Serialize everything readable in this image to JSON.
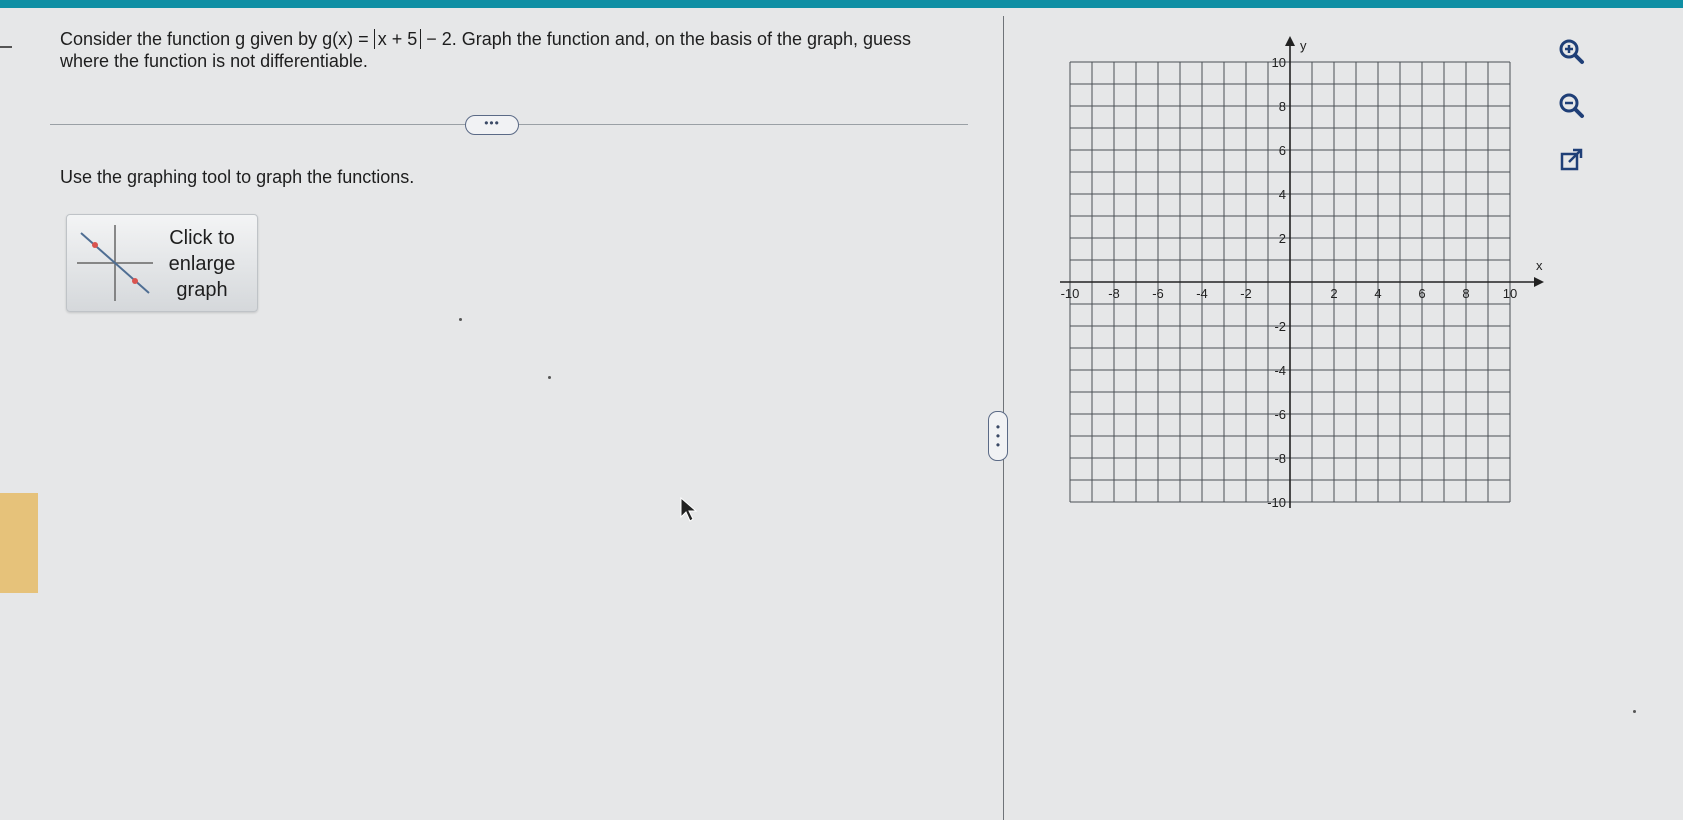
{
  "question": {
    "intro": "Consider the function g given by g(x) = ",
    "abs_expr": "x + 5",
    "after_abs": " − 2. Graph the function and, on the basis of the graph, guess where the function is not differentiable."
  },
  "expand_button_label": "•••",
  "instruction": "Use the graphing tool to graph the functions.",
  "enlarge_button": {
    "line1": "Click to",
    "line2": "enlarge",
    "line3": "graph"
  },
  "vertical_handle_label": "•••",
  "graph": {
    "x_axis_label": "x",
    "y_axis_label": "y",
    "x_min": -10,
    "x_max": 10,
    "y_min": -10,
    "y_max": 10,
    "grid_step": 1,
    "x_tick_labels": [
      "-10",
      "-8",
      "-6",
      "-4",
      "-2",
      "2",
      "4",
      "6",
      "8",
      "10"
    ],
    "y_tick_labels": [
      "10",
      "8",
      "6",
      "4",
      "2",
      "-2",
      "-4",
      "-6",
      "-8",
      "-10"
    ]
  },
  "tools": [
    "zoom-in-icon",
    "zoom-out-icon",
    "external-link-icon"
  ],
  "colors": {
    "topbar": "#0f8fa4",
    "grid": "#4a4f55",
    "background": "#e6e7e8",
    "accent": "#e6c27a"
  }
}
